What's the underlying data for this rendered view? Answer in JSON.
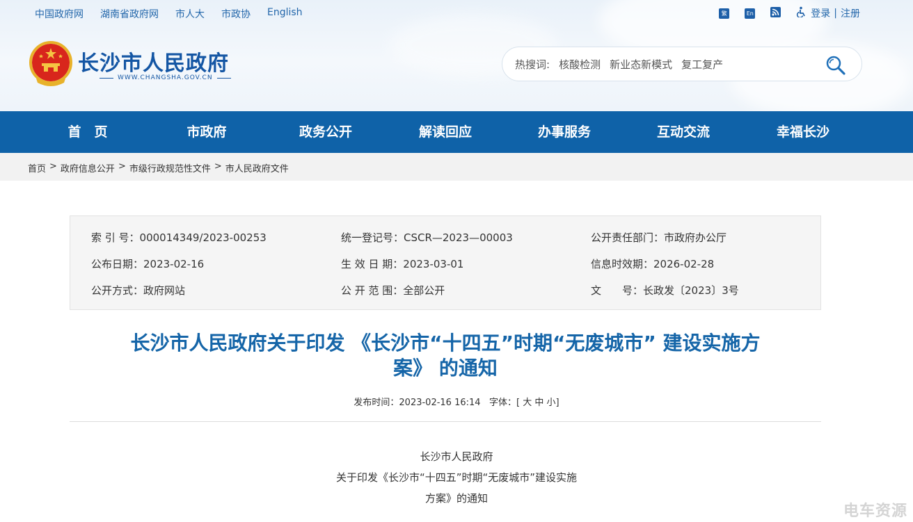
{
  "top_links": [
    "中国政府网",
    "湖南省政府网",
    "市人大",
    "市政协",
    "English"
  ],
  "top_right": {
    "icon_fan": "繁",
    "icon_en": "En",
    "login": "登录",
    "separator": "|",
    "register": "注册"
  },
  "brand": {
    "title": "长沙市人民政府",
    "subtitle": "WWW.CHANGSHA.GOV.CN"
  },
  "search": {
    "hot_label": "热搜词:",
    "keywords": [
      "核酸检测",
      "新业态新模式",
      "复工复产"
    ]
  },
  "nav": [
    "首　页",
    "市政府",
    "政务公开",
    "解读回应",
    "办事服务",
    "互动交流",
    "幸福长沙"
  ],
  "breadcrumb": [
    "首页",
    "政府信息公开",
    "市级行政规范性文件",
    "市人民政府文件"
  ],
  "meta": {
    "index_no": "索 引 号：000014349/2023-00253",
    "reg_no": "统一登记号：CSCR—2023—00003",
    "dept": "公开责任部门：市政府办公厅",
    "pub_date": "公布日期：2023-02-16",
    "effective_date": "生 效 日 期：2023-03-01",
    "valid_until": "信息时效期：2026-02-28",
    "pub_method": "公开方式：政府网站",
    "pub_scope": "公 开 范 围：全部公开",
    "doc_no_label": "文　　号：",
    "doc_no": "长政发〔2023〕3号"
  },
  "article": {
    "title_line1": "长沙市人民政府关于印发 《长沙市“十四五”时期“无废城市” 建设实施方",
    "title_line2": "案》 的通知",
    "publish_label": "发布时间：",
    "publish_time": "2023-02-16 16:14",
    "font_label": "字体：[",
    "font_large": "大",
    "font_medium": "中",
    "font_small": "小",
    "font_end": "]",
    "body_lines": [
      "长沙市人民政府",
      "关于印发《长沙市“十四五”时期“无废城市”建设实施",
      "方案》的通知"
    ]
  },
  "watermark": "电车资源",
  "colors": {
    "nav_bg": "#0f62a8",
    "brand_blue": "#1456a4",
    "title_blue": "#1565a8"
  }
}
